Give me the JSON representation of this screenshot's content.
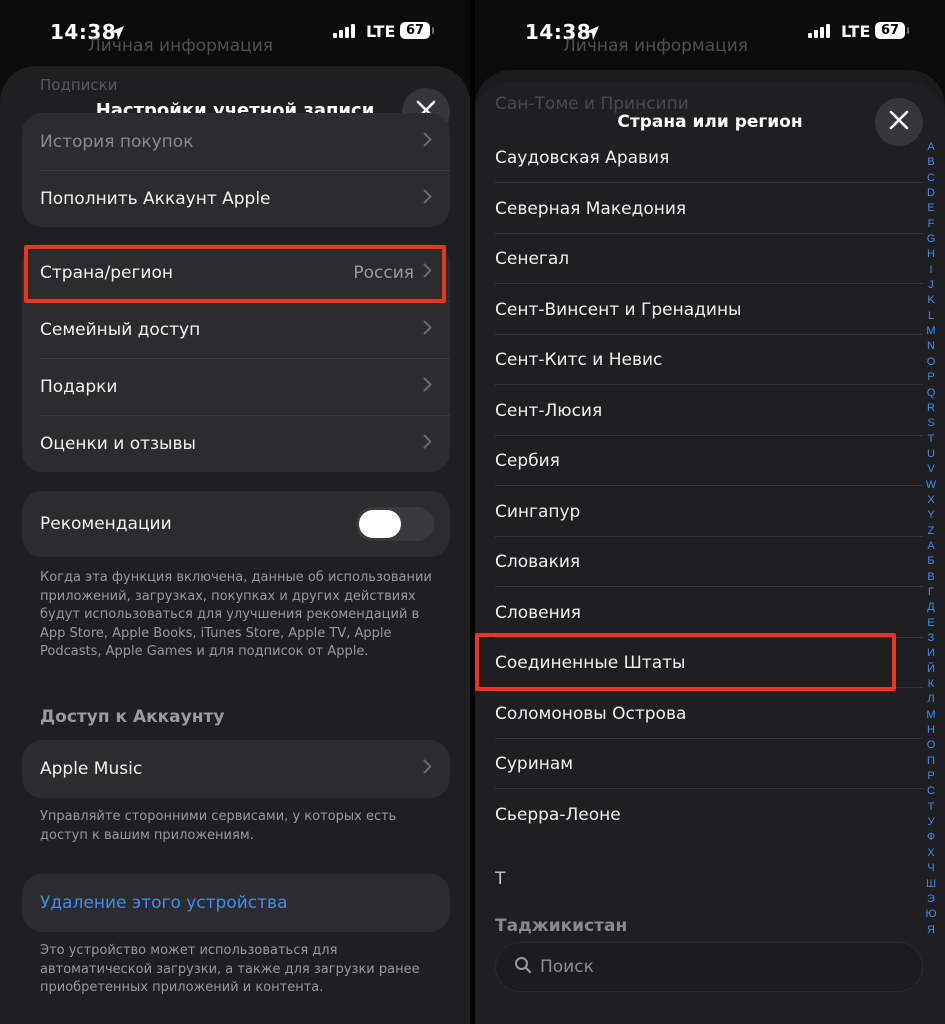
{
  "status": {
    "time": "14:38",
    "network": "LTE",
    "battery": "67"
  },
  "left": {
    "peek_items": [
      "Личная информация",
      "Подписки"
    ],
    "title": "Настройки учетной записи",
    "group1": [
      {
        "label": "История покупок"
      },
      {
        "label": "Пополнить Аккаунт Apple"
      }
    ],
    "group2": [
      {
        "label": "Страна/регион",
        "value": "Россия"
      },
      {
        "label": "Семейный доступ"
      },
      {
        "label": "Подарки"
      },
      {
        "label": "Оценки и отзывы"
      }
    ],
    "recommendations": {
      "label": "Рекомендации",
      "enabled": false,
      "note": "Когда эта функция включена, данные об использовании приложений, загрузках, покупках и других действиях будут использоваться для улучшения рекомендаций в App Store, Apple Books, iTunes Store, Apple TV, Apple Podcasts, Apple Games и для подписок от Apple."
    },
    "account_access": {
      "header": "Доступ к Аккаунту",
      "item": "Apple Music",
      "note": "Управляйте сторонними сервисами, у которых есть доступ к вашим приложениям."
    },
    "remove_device": {
      "label": "Удаление этого устройства",
      "note": "Это устройство может использоваться для автоматической загрузки, а также для загрузки ранее приобретенных приложений и контента."
    }
  },
  "right": {
    "peek_items": [
      "Личная информация",
      "Сан-Томе и Принсипи"
    ],
    "title": "Страна или регион",
    "countries": [
      "Саудовская Аравия",
      "Северная Македония",
      "Сенегал",
      "Сент-Винсент и Гренадины",
      "Сент-Китс и Невис",
      "Сент-Люсия",
      "Сербия",
      "Сингапур",
      "Словакия",
      "Словения",
      "Соединенные Штаты",
      "Соломоновы Острова",
      "Суринам",
      "Сьерра-Леоне"
    ],
    "section_t": "Т",
    "next_country": "Таджикистан",
    "index_letters": [
      "A",
      "B",
      "C",
      "D",
      "E",
      "F",
      "G",
      "H",
      "I",
      "J",
      "K",
      "L",
      "M",
      "N",
      "O",
      "P",
      "Q",
      "R",
      "S",
      "T",
      "U",
      "V",
      "W",
      "X",
      "Y",
      "Z",
      "А",
      "Б",
      "В",
      "Г",
      "Д",
      "Е",
      "З",
      "И",
      "Й",
      "К",
      "Л",
      "М",
      "Н",
      "О",
      "П",
      "Р",
      "С",
      "Т",
      "У",
      "Ф",
      "Х",
      "Ч",
      "Ш",
      "Э",
      "Ю",
      "Я"
    ],
    "search_placeholder": "Поиск"
  },
  "colors": {
    "highlight": "#e8351e",
    "link": "#3b8ef2",
    "sheet": "#1f1f22",
    "cell": "#2c2c2f"
  }
}
